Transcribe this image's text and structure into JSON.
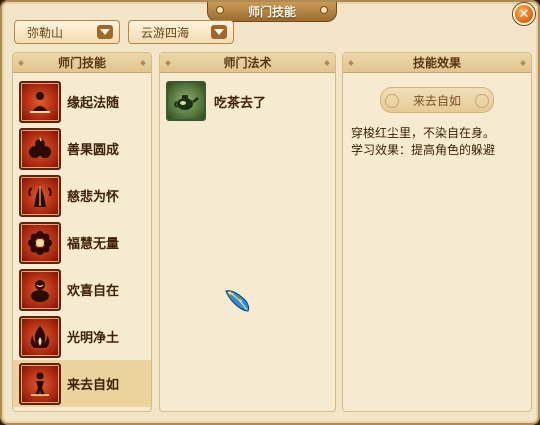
{
  "window": {
    "title": "师门技能",
    "close_glyph": "✕"
  },
  "filters": [
    {
      "value": "弥勒山"
    },
    {
      "value": "云游四海"
    }
  ],
  "panels": {
    "skills": {
      "header": "师门技能",
      "items": [
        {
          "label": "缘起法随",
          "icon": "sitting-figure-icon"
        },
        {
          "label": "善果圆成",
          "icon": "fruits-icon"
        },
        {
          "label": "慈悲为怀",
          "icon": "praying-hands-icon"
        },
        {
          "label": "福慧无量",
          "icon": "lotus-flower-icon"
        },
        {
          "label": "欢喜自在",
          "icon": "laughing-buddha-icon"
        },
        {
          "label": "光明净土",
          "icon": "flame-icon"
        },
        {
          "label": "来去自如",
          "icon": "walking-figure-icon"
        }
      ],
      "selected_index": 6
    },
    "spells": {
      "header": "师门法术",
      "items": [
        {
          "label": "吃茶去了",
          "icon": "teapot-icon"
        }
      ]
    },
    "effect": {
      "header": "技能效果",
      "banner": "来去自如",
      "line1": "穿梭红尘里，不染自在身。",
      "line2": "学习效果：提高角色的躲避"
    }
  },
  "colors": {
    "accent": "#9c6b30",
    "icon_red": "#a3240e",
    "selected_row": "#ecd29c"
  }
}
